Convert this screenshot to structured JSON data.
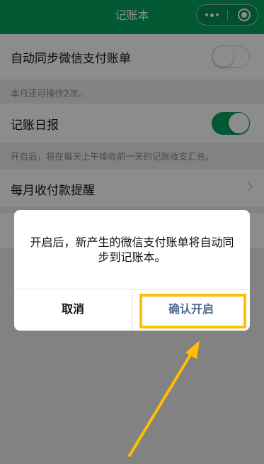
{
  "header": {
    "title": "记账本",
    "more_icon": "more-dots-icon",
    "close_icon": "target-circle-icon",
    "background": "#07a35f"
  },
  "settings": {
    "sync_wechat": {
      "label": "自动同步微信支付账单",
      "enabled": false
    },
    "sync_hint": "本月还可操作2次。",
    "daily_report": {
      "label": "记账日报",
      "enabled": true
    },
    "daily_hint": "开启后，将在每天上午接收前一天的记账收支汇总。",
    "monthly_reminder": {
      "label": "每月收付款提醒"
    }
  },
  "dialog": {
    "message": "开启后，新产生的微信支付账单将自动同步到记账本。",
    "cancel_label": "取消",
    "confirm_label": "确认开启",
    "confirm_color": "#576b95"
  },
  "annotation": {
    "highlight_color": "#ffbf00"
  }
}
